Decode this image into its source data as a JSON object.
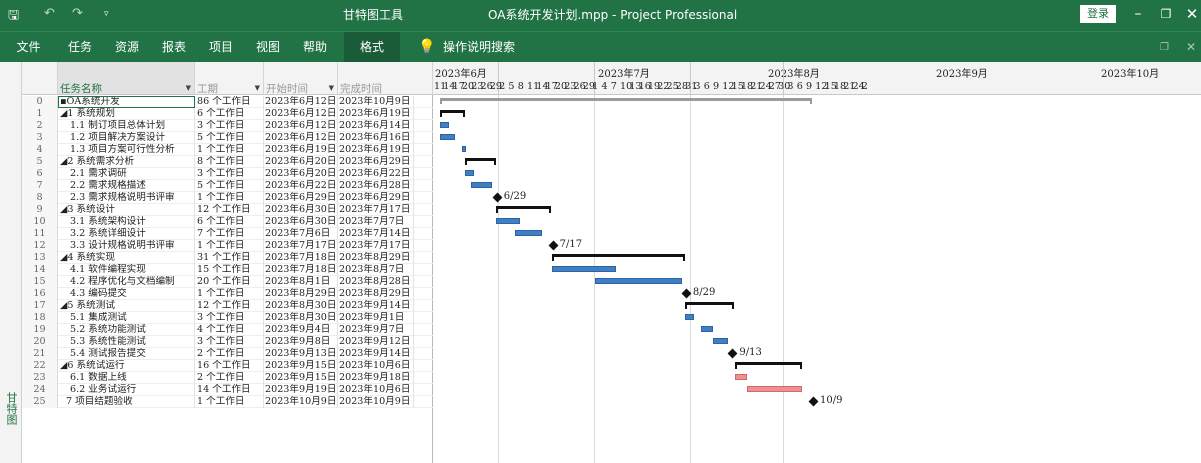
{
  "titlebar": {
    "context_tab": "甘特图工具",
    "file_title": "OA系统开发计划.mpp",
    "separator": "-",
    "app_name": "Project Professional",
    "login": "登录"
  },
  "ribbon": {
    "tabs": [
      "文件",
      "任务",
      "资源",
      "报表",
      "项目",
      "视图",
      "帮助",
      "格式"
    ],
    "tell_me": "操作说明搜索"
  },
  "side_label": "甘特图",
  "columns": {
    "name": "任务名称",
    "duration": "工期",
    "start": "开始时间",
    "finish": "完成时间"
  },
  "tasks": [
    {
      "id": "0",
      "name": "▪OA系统开发",
      "duration": "86 个工作日",
      "start": "2023年6月12日",
      "finish": "2023年10月9日"
    },
    {
      "id": "1",
      "name": "◢1 系统规划",
      "duration": "6 个工作日",
      "start": "2023年6月12日",
      "finish": "2023年6月19日"
    },
    {
      "id": "2",
      "name": "1.1 制订项目总体计划",
      "duration": "3 个工作日",
      "start": "2023年6月12日",
      "finish": "2023年6月14日"
    },
    {
      "id": "3",
      "name": "1.2 项目解决方案设计",
      "duration": "5 个工作日",
      "start": "2023年6月12日",
      "finish": "2023年6月16日"
    },
    {
      "id": "4",
      "name": "1.3 项目方案可行性分析",
      "duration": "1 个工作日",
      "start": "2023年6月19日",
      "finish": "2023年6月19日"
    },
    {
      "id": "5",
      "name": "◢2 系统需求分析",
      "duration": "8 个工作日",
      "start": "2023年6月20日",
      "finish": "2023年6月29日"
    },
    {
      "id": "6",
      "name": "2.1 需求调研",
      "duration": "3 个工作日",
      "start": "2023年6月20日",
      "finish": "2023年6月22日"
    },
    {
      "id": "7",
      "name": "2.2 需求规格描述",
      "duration": "5 个工作日",
      "start": "2023年6月22日",
      "finish": "2023年6月28日"
    },
    {
      "id": "8",
      "name": "2.3 需求规格说明书评审",
      "duration": "1 个工作日",
      "start": "2023年6月29日",
      "finish": "2023年6月29日"
    },
    {
      "id": "9",
      "name": "◢3 系统设计",
      "duration": "12 个工作日",
      "start": "2023年6月30日",
      "finish": "2023年7月17日"
    },
    {
      "id": "10",
      "name": "3.1 系统架构设计",
      "duration": "6 个工作日",
      "start": "2023年6月30日",
      "finish": "2023年7月7日"
    },
    {
      "id": "11",
      "name": "3.2 系统详细设计",
      "duration": "7 个工作日",
      "start": "2023年7月6日",
      "finish": "2023年7月14日"
    },
    {
      "id": "12",
      "name": "3.3 设计规格说明书评审",
      "duration": "1 个工作日",
      "start": "2023年7月17日",
      "finish": "2023年7月17日"
    },
    {
      "id": "13",
      "name": "◢4 系统实现",
      "duration": "31 个工作日",
      "start": "2023年7月18日",
      "finish": "2023年8月29日"
    },
    {
      "id": "14",
      "name": "4.1 软件编程实现",
      "duration": "15 个工作日",
      "start": "2023年7月18日",
      "finish": "2023年8月7日"
    },
    {
      "id": "15",
      "name": "4.2 程序优化与文档编制",
      "duration": "20 个工作日",
      "start": "2023年8月1日",
      "finish": "2023年8月28日"
    },
    {
      "id": "16",
      "name": "4.3 编码提交",
      "duration": "1 个工作日",
      "start": "2023年8月29日",
      "finish": "2023年8月29日"
    },
    {
      "id": "17",
      "name": "◢5 系统测试",
      "duration": "12 个工作日",
      "start": "2023年8月30日",
      "finish": "2023年9月14日"
    },
    {
      "id": "18",
      "name": "5.1 集成测试",
      "duration": "3 个工作日",
      "start": "2023年8月30日",
      "finish": "2023年9月1日"
    },
    {
      "id": "19",
      "name": "5.2 系统功能测试",
      "duration": "4 个工作日",
      "start": "2023年9月4日",
      "finish": "2023年9月7日"
    },
    {
      "id": "20",
      "name": "5.3 系统性能测试",
      "duration": "3 个工作日",
      "start": "2023年9月8日",
      "finish": "2023年9月12日"
    },
    {
      "id": "21",
      "name": "5.4 测试报告提交",
      "duration": "2 个工作日",
      "start": "2023年9月13日",
      "finish": "2023年9月14日"
    },
    {
      "id": "22",
      "name": "◢6 系统试运行",
      "duration": "16 个工作日",
      "start": "2023年9月15日",
      "finish": "2023年10月6日"
    },
    {
      "id": "23",
      "name": "6.1 数据上线",
      "duration": "2 个工作日",
      "start": "2023年9月15日",
      "finish": "2023年9月18日"
    },
    {
      "id": "24",
      "name": "6.2 业务试运行",
      "duration": "14 个工作日",
      "start": "2023年9月19日",
      "finish": "2023年10月6日"
    },
    {
      "id": "25",
      "name": "7 项目结题验收",
      "duration": "1 个工作日",
      "start": "2023年10月9日",
      "finish": "2023年10月9日"
    }
  ],
  "timescale": {
    "months": [
      "2023年6月",
      "2023年7月",
      "2023年8月",
      "2023年9月",
      "2023年10月"
    ],
    "days": [
      "11",
      "14",
      "17",
      "20",
      "23",
      "26",
      "29",
      "2",
      "5",
      "8",
      "11",
      "14",
      "17",
      "20",
      "23",
      "26",
      "29",
      "1",
      "4",
      "7",
      "10",
      "13",
      "16",
      "19",
      "22",
      "25",
      "28",
      "31",
      "3",
      "6",
      "9",
      "12",
      "15",
      "18",
      "21",
      "24",
      "27",
      "30",
      "3",
      "6",
      "9",
      "12",
      "15",
      "18",
      "21",
      "24",
      "2"
    ]
  },
  "milestone_labels": {
    "8": "6/29",
    "12": "7/17",
    "16": "8/29",
    "21": "9/13",
    "25": "10/9"
  },
  "colors": {
    "brand_green": "#217346",
    "task_bar": "#3f7fc4",
    "critical_bar": "#ef8f8f",
    "summary_bar": "#111111"
  }
}
